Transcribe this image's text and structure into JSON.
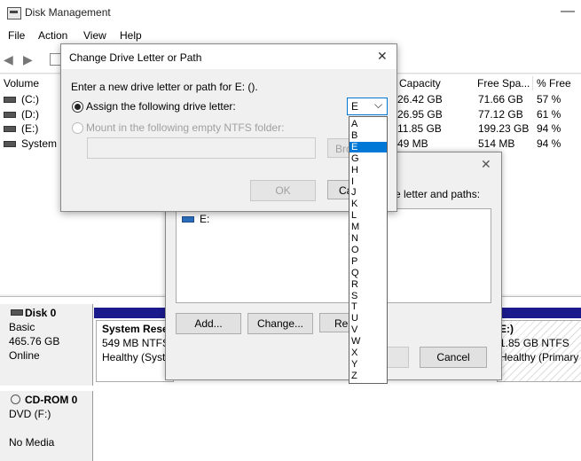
{
  "window": {
    "title": "Disk Management",
    "minimize_glyph": "—"
  },
  "menu": [
    "File",
    "Action",
    "View",
    "Help"
  ],
  "toolbar_icons": [
    "back-arrow-icon",
    "forward-arrow-icon",
    "properties-icon"
  ],
  "volume_table": {
    "columns": [
      "Volume",
      "Capacity",
      "Free Spa...",
      "% Free"
    ],
    "rows": [
      {
        "volume": "(C:)",
        "capacity": "26.42 GB",
        "free": "71.66 GB",
        "pct": "57 %"
      },
      {
        "volume": "(D:)",
        "capacity": "26.95 GB",
        "free": "77.12 GB",
        "pct": "61 %"
      },
      {
        "volume": "(E:)",
        "capacity": "11.85 GB",
        "free": "199.23 GB",
        "pct": "94 %"
      },
      {
        "volume": "System R",
        "capacity": "49 MB",
        "free": "514 MB",
        "pct": "94 %"
      }
    ]
  },
  "disks": [
    {
      "name": "Disk 0",
      "lines": [
        "Basic",
        "465.76 GB",
        "Online"
      ]
    },
    {
      "name": "CD-ROM 0",
      "lines": [
        "DVD (F:)",
        "",
        "No Media"
      ]
    }
  ],
  "partitions": {
    "system": [
      "System Reser",
      "549 MB NTFS",
      "Healthy (Syste"
    ],
    "e_drive": [
      "E:)",
      "1.85 GB NTFS",
      "Healthy (Primary Pa"
    ]
  },
  "back_dialog": {
    "close_glyph": "✕",
    "prompt": "ve letter and paths:",
    "list_item": "E:",
    "buttons": {
      "add": "Add...",
      "change": "Change...",
      "remove": "Ren",
      "cancel": "Cancel"
    }
  },
  "front_dialog": {
    "title": "Change Drive Letter or Path",
    "close_glyph": "✕",
    "prompt": "Enter a new drive letter or path for E: ().",
    "assign_label": "Assign the following drive letter:",
    "mount_label": "Mount in the following empty NTFS folder:",
    "browse_label": "Bro",
    "ok_label": "OK",
    "cancel_label": "Ca",
    "selected_letter": "E",
    "dropdown_arrow": "⌵"
  },
  "drive_letters": [
    "A",
    "B",
    "E",
    "G",
    "H",
    "I",
    "J",
    "K",
    "L",
    "M",
    "N",
    "O",
    "P",
    "Q",
    "R",
    "S",
    "T",
    "U",
    "V",
    "W",
    "X",
    "Y",
    "Z"
  ],
  "selected_index": 2
}
